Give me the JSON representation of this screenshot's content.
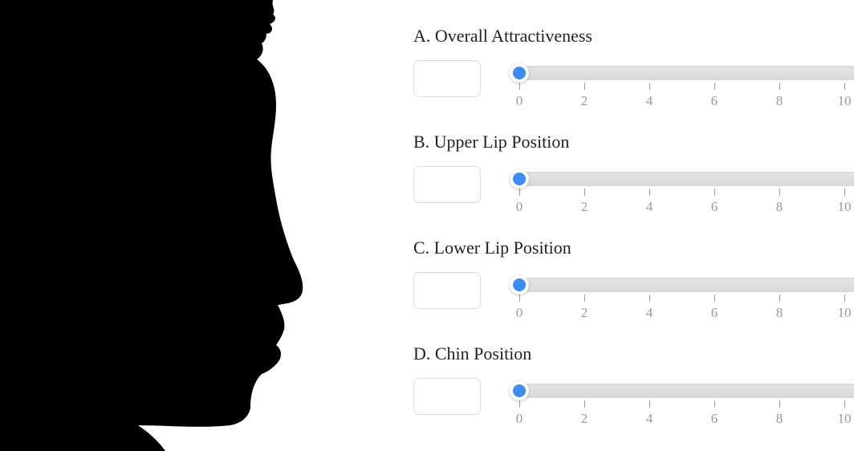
{
  "questions": [
    {
      "label": "A. Overall Attractiveness",
      "value": "",
      "slider_value": 0
    },
    {
      "label": "B. Upper Lip Position",
      "value": "",
      "slider_value": 0
    },
    {
      "label": "C. Lower Lip Position",
      "value": "",
      "slider_value": 0
    },
    {
      "label": "D. Chin Position",
      "value": "",
      "slider_value": 0
    }
  ],
  "scale": {
    "min": 0,
    "max": 10,
    "tick_labels": [
      "0",
      "2",
      "4",
      "6",
      "8",
      "10"
    ]
  },
  "colors": {
    "thumb": "#3d8cf5",
    "track": "#dedede",
    "silhouette": "#000000"
  }
}
